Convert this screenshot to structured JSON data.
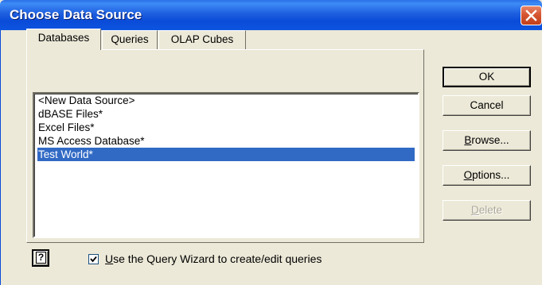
{
  "window": {
    "title": "Choose Data Source"
  },
  "tabs": [
    {
      "label": "Databases",
      "active": true
    },
    {
      "label": "Queries",
      "active": false
    },
    {
      "label": "OLAP Cubes",
      "active": false
    }
  ],
  "list": {
    "items": [
      {
        "label": "<New Data Source>",
        "selected": false
      },
      {
        "label": "dBASE Files*",
        "selected": false
      },
      {
        "label": "Excel Files*",
        "selected": false
      },
      {
        "label": "MS Access Database*",
        "selected": false
      },
      {
        "label": "Test World*",
        "selected": true
      }
    ]
  },
  "buttons": {
    "ok": "OK",
    "cancel": "Cancel",
    "browse": {
      "mnemonic": "B",
      "rest": "rowse..."
    },
    "options": {
      "mnemonic": "O",
      "rest": "ptions..."
    },
    "delete": {
      "mnemonic": "D",
      "rest": "elete"
    }
  },
  "footer": {
    "help_glyph": "?",
    "query_wizard": {
      "checked": true,
      "mnemonic": "U",
      "rest": "se the Query Wizard to create/edit queries"
    }
  },
  "colors": {
    "selection": "#316ac5",
    "dialog_bg": "#ece9d8",
    "titlebar": "#0a4bd8"
  },
  "icons": {
    "close": "close-icon",
    "help": "help-icon",
    "check": "checkmark-icon"
  }
}
